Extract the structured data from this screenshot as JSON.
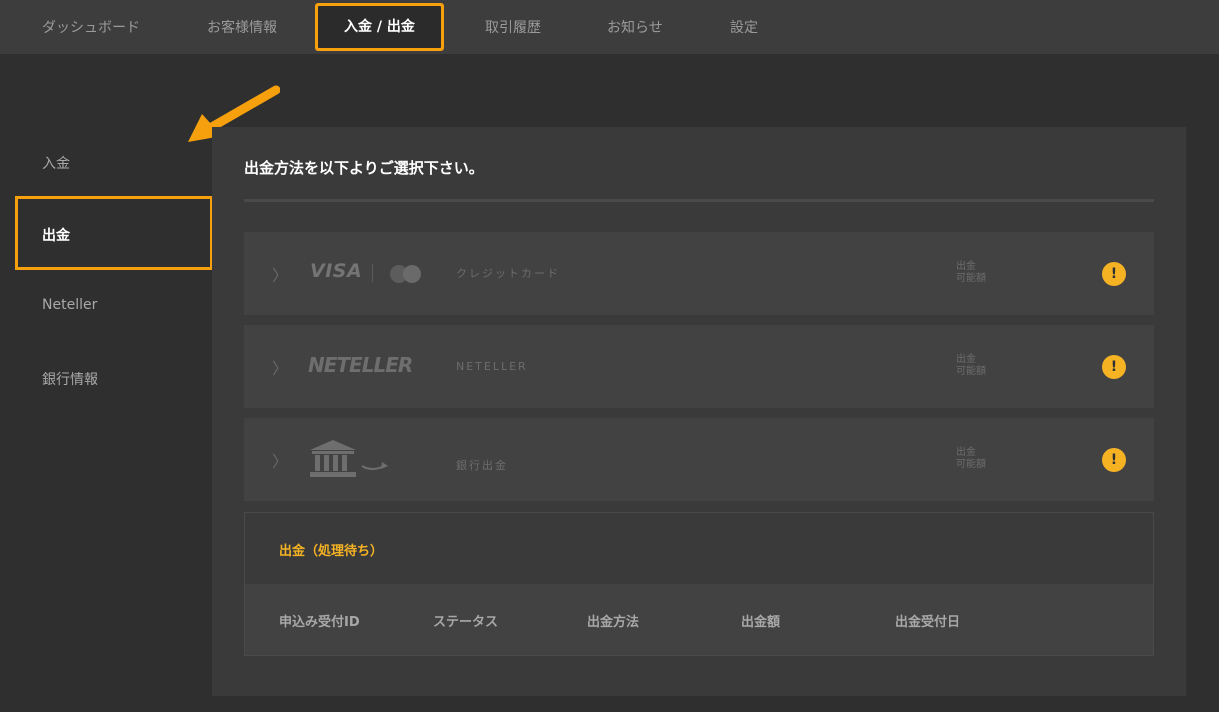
{
  "nav": {
    "tabs": [
      {
        "label": "ダッシュボード"
      },
      {
        "label": "お客様情報"
      },
      {
        "label": "入金 / 出金"
      },
      {
        "label": "取引履歴"
      },
      {
        "label": "お知らせ"
      },
      {
        "label": "設定"
      }
    ]
  },
  "sidebar": {
    "items": [
      {
        "label": "入金"
      },
      {
        "label": "出金"
      },
      {
        "label": "Neteller"
      },
      {
        "label": "銀行情報"
      }
    ]
  },
  "main": {
    "title": "出金方法を以下よりご選択下さい。",
    "methods": [
      {
        "logo": "VISA",
        "label": "クレジットカード",
        "available": "出金\n可能額",
        "warn": "!"
      },
      {
        "logo": "NETELLER",
        "label": "NETELLER",
        "available": "出金\n可能額",
        "warn": "!"
      },
      {
        "logo": "bank-icon",
        "label": "銀行出金",
        "available": "出金\n可能額",
        "warn": "!"
      }
    ],
    "pending": {
      "title": "出金（処理待ち）",
      "columns": [
        "申込み受付ID",
        "ステータス",
        "出金方法",
        "出金額",
        "出金受付日"
      ]
    }
  },
  "colors": {
    "accent": "#f5a00c",
    "warning": "#f5b324",
    "background": "#2f2f2f",
    "panel": "#3a3a3a"
  }
}
